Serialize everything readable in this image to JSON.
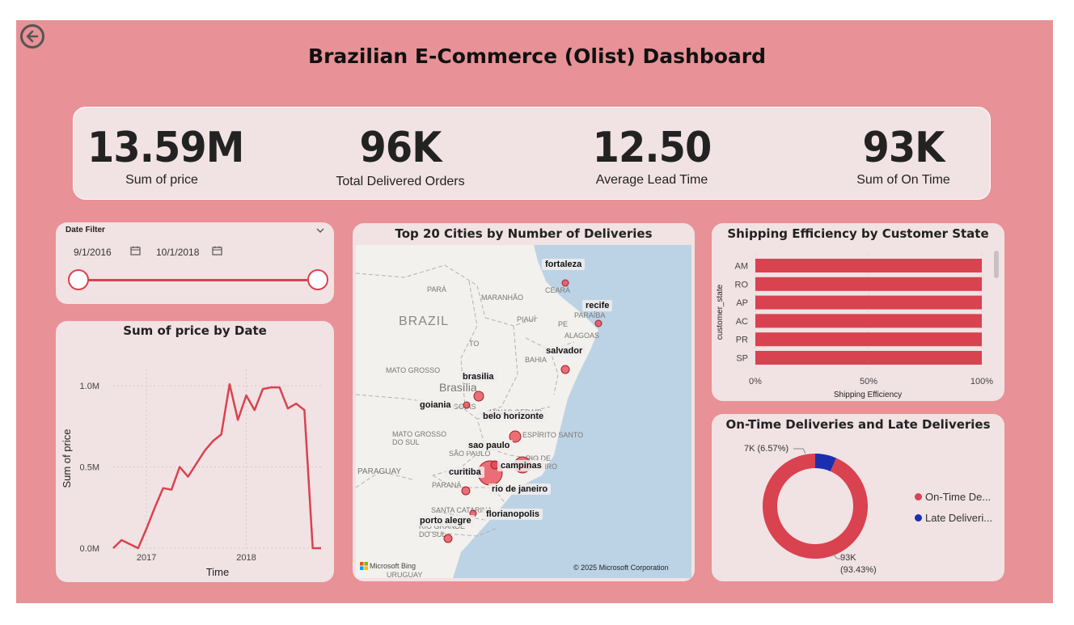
{
  "title": "Brazilian E-Commerce (Olist) Dashboard",
  "kpis": [
    {
      "value": "13.59M",
      "label": "Sum of price"
    },
    {
      "value": "96K",
      "label": "Total Delivered Orders"
    },
    {
      "value": "12.50",
      "label": "Average Lead Time"
    },
    {
      "value": "93K",
      "label": "Sum of On Time"
    }
  ],
  "date_filter": {
    "title": "Date Filter",
    "start": "9/1/2016",
    "end": "10/1/2018",
    "range_start": 0.0,
    "range_end": 1.0
  },
  "line_chart": {
    "title": "Sum of price by Date",
    "xlabel": "Time",
    "ylabel": "Sum of price",
    "y_ticks": [
      "1.0M",
      "0.5M",
      "0.0M"
    ],
    "x_ticks": [
      "2017",
      "2018"
    ]
  },
  "map": {
    "title": "Top 20 Cities by Number of Deliveries",
    "base_labels": [
      "PARÁ",
      "MARANHÃO",
      "CEARÁ",
      "BRAZIL",
      "PIAUÍ",
      "PE",
      "PARAÍBA",
      "ALAGOAS",
      "TO",
      "BAHIA",
      "MATO GROSSO",
      "Brasília",
      "GOIÁS",
      "MINAS GERAIS",
      "MATO GROSSO DO SUL",
      "ESPÍRITO SANTO",
      "SÃO PAULO",
      "RIO DE JANEIRO",
      "PARAGUAY",
      "PARANÁ",
      "SANTA CATARINA",
      "RIO GRANDE DO SUL",
      "URUGUAY"
    ],
    "cities": [
      "fortaleza",
      "recife",
      "salvador",
      "brasilia",
      "goiania",
      "belo horizonte",
      "sao paulo",
      "campinas",
      "curitiba",
      "rio de janeiro",
      "florianopolis",
      "porto alegre"
    ],
    "attribution_left": "Microsoft Bing",
    "attribution_right": "© 2025 Microsoft Corporation"
  },
  "bar_chart": {
    "title": "Shipping Efficiency by Customer State",
    "ylabel": "customer_state",
    "xlabel": "Shipping Efficiency",
    "x_ticks": [
      "0%",
      "50%",
      "100%"
    ]
  },
  "donut": {
    "title": "On-Time Deliveries and Late Deliveries",
    "late_label": "7K (6.57%)",
    "ontime_label_1": "93K",
    "ontime_label_2": "(93.43%)",
    "legend": [
      {
        "label": "On-Time De...",
        "color": "#d9424f"
      },
      {
        "label": "Late Deliveri...",
        "color": "#1a2fb0"
      }
    ]
  },
  "chart_data": [
    {
      "type": "line",
      "title": "Sum of price by Date",
      "xlabel": "Time",
      "ylabel": "Sum of price",
      "x": [
        "2016-09",
        "2016-10",
        "2016-12",
        "2017-01",
        "2017-02",
        "2017-03",
        "2017-04",
        "2017-05",
        "2017-06",
        "2017-07",
        "2017-08",
        "2017-09",
        "2017-10",
        "2017-11",
        "2017-12",
        "2018-01",
        "2018-02",
        "2018-03",
        "2018-04",
        "2018-05",
        "2018-06",
        "2018-07",
        "2018-08",
        "2018-09",
        "2018-10"
      ],
      "values": [
        0.0,
        0.05,
        0.0,
        0.12,
        0.25,
        0.37,
        0.36,
        0.5,
        0.44,
        0.52,
        0.6,
        0.66,
        0.7,
        1.01,
        0.79,
        0.94,
        0.85,
        0.98,
        0.99,
        0.99,
        0.86,
        0.89,
        0.85,
        0.0,
        0.0
      ],
      "ylim": [
        0,
        1.1
      ],
      "color": "#d9424f"
    },
    {
      "type": "bar",
      "title": "Shipping Efficiency by Customer State",
      "xlabel": "Shipping Efficiency",
      "ylabel": "customer_state",
      "categories": [
        "AM",
        "RO",
        "AP",
        "AC",
        "PR",
        "SP"
      ],
      "values": [
        100,
        100,
        100,
        100,
        100,
        100
      ],
      "xlim": [
        0,
        100
      ],
      "color": "#d9424f"
    },
    {
      "type": "pie",
      "title": "On-Time Deliveries and Late Deliveries",
      "categories": [
        "On-Time Deliveries",
        "Late Deliveries"
      ],
      "values": [
        93.43,
        6.57
      ],
      "colors": [
        "#d9424f",
        "#1a2fb0"
      ]
    }
  ]
}
